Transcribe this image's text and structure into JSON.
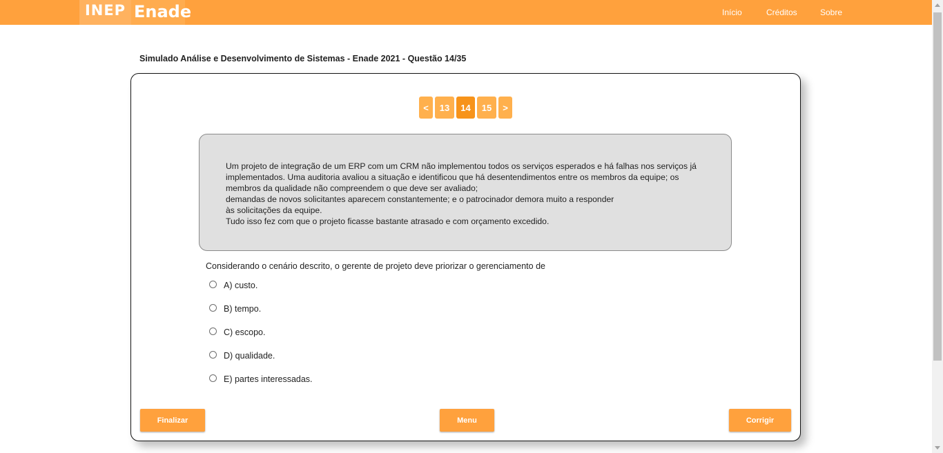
{
  "header": {
    "logo_inep": "INEP",
    "logo_enade": "Enade",
    "nav": [
      "Início",
      "Créditos",
      "Sobre"
    ]
  },
  "page_title": "Simulado Análise e Desenvolvimento de Sistemas - Enade 2021 - Questão 14/35",
  "pager": {
    "prev": "<",
    "pages": [
      "13",
      "14",
      "15"
    ],
    "current": "14",
    "next": ">"
  },
  "scenario": [
    "Um projeto de integração de um ERP com um CRM não implementou todos os serviços esperados e há falhas nos serviços já",
    "implementados. Uma auditoria avaliou a situação e identificou que há desentendimentos entre os membros da equipe; os",
    "membros da qualidade não compreendem o que deve ser avaliado;",
    "demandas de novos solicitantes aparecem constantemente; e o patrocinador demora muito a responder",
    "às solicitações da equipe.",
    "Tudo isso fez com que o projeto ficasse bastante atrasado e com orçamento excedido."
  ],
  "question": "Considerando o cenário descrito, o gerente de projeto deve priorizar o gerenciamento de",
  "options": [
    "A) custo.",
    "B) tempo.",
    "C) escopo.",
    "D) qualidade.",
    "E) partes interessadas."
  ],
  "actions": {
    "finish": "Finalizar",
    "menu": "Menu",
    "correct": "Corrigir"
  },
  "colors": {
    "brand_orange": "#ffa13d",
    "pager_active": "#f7931a",
    "scenario_bg": "#e0e0e0"
  }
}
